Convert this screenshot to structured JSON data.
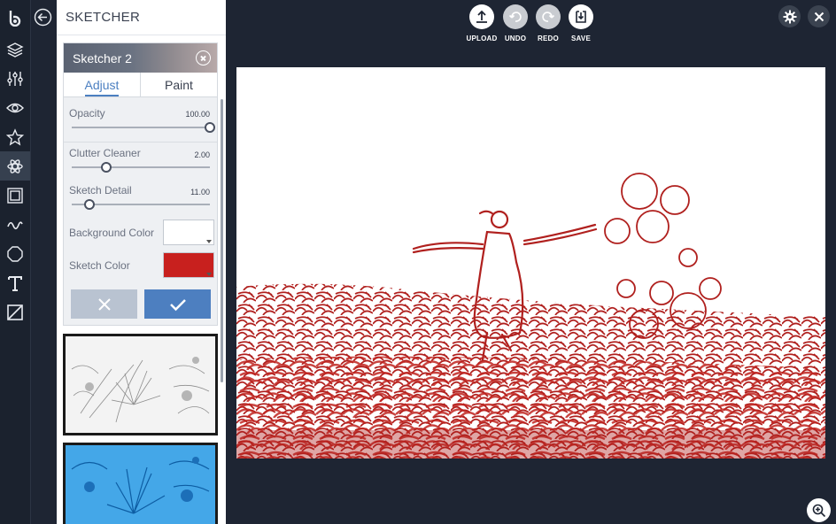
{
  "panel": {
    "title": "SKETCHER",
    "card": {
      "title": "Sketcher 2",
      "tabs": [
        {
          "label": "Adjust",
          "active": true
        },
        {
          "label": "Paint",
          "active": false
        }
      ],
      "sliders": [
        {
          "label": "Opacity",
          "value": "100.00",
          "fraction": 1.0
        },
        {
          "label": "Clutter Cleaner",
          "value": "2.00",
          "fraction": 0.25
        },
        {
          "label": "Sketch Detail",
          "value": "11.00",
          "fraction": 0.13
        }
      ],
      "colors": [
        {
          "label": "Background Color",
          "value": "#ffffff"
        },
        {
          "label": "Sketch Color",
          "value": "#c8201e"
        }
      ],
      "cancel_icon": "close-icon",
      "apply_icon": "check-icon"
    },
    "presets": [
      {
        "style": "pencil-sketch"
      },
      {
        "style": "blue-sketch"
      }
    ]
  },
  "toolbar": {
    "upload": "UPLOAD",
    "undo": "UNDO",
    "redo": "REDO",
    "save": "SAVE"
  },
  "rail": {
    "items": [
      "logo-icon",
      "layers-icon",
      "adjust-icon",
      "eye-icon",
      "star-icon",
      "effects-icon",
      "frame-icon",
      "draw-icon",
      "shape-icon",
      "text-icon",
      "texture-icon"
    ],
    "active": "effects-icon"
  },
  "colors": {
    "accent": "#4d7fc0",
    "sketch": "#c8201e",
    "background": "#1e2533"
  }
}
